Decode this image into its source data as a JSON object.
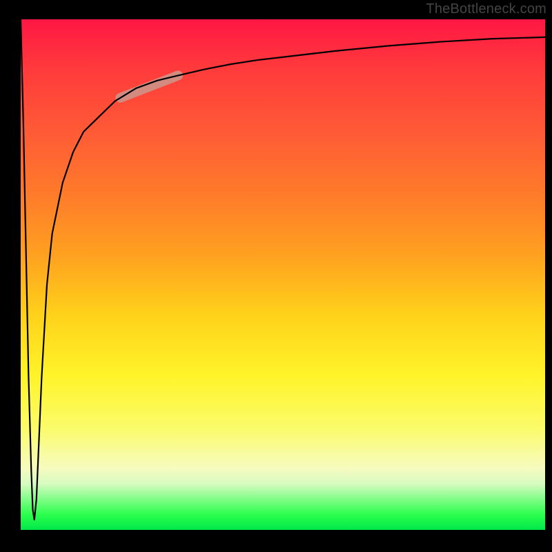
{
  "watermark": "TheBottleneck.com",
  "chart_data": {
    "type": "line",
    "title": "",
    "xlabel": "",
    "ylabel": "",
    "xlim": [
      0,
      100
    ],
    "ylim": [
      0,
      100
    ],
    "grid": false,
    "legend": false,
    "background_gradient": {
      "top": "#ff1744",
      "mid": "#ffd21a",
      "bottom": "#00e84a"
    },
    "highlight_segment": {
      "x_start": 19,
      "x_end": 30,
      "color": "#cf9387"
    },
    "series": [
      {
        "name": "curve",
        "x": [
          0,
          0.5,
          1,
          1.5,
          2,
          2.3,
          2.6,
          3,
          3.5,
          4,
          5,
          6,
          8,
          10,
          12,
          15,
          18,
          22,
          26,
          30,
          35,
          40,
          45,
          50,
          60,
          70,
          80,
          90,
          100
        ],
        "y": [
          100,
          80,
          55,
          30,
          12,
          4,
          2,
          6,
          18,
          30,
          48,
          58,
          68,
          74,
          78,
          81,
          84,
          86.5,
          88,
          89,
          90.2,
          91.2,
          92,
          92.6,
          93.8,
          94.8,
          95.6,
          96.2,
          96.5
        ]
      }
    ]
  }
}
